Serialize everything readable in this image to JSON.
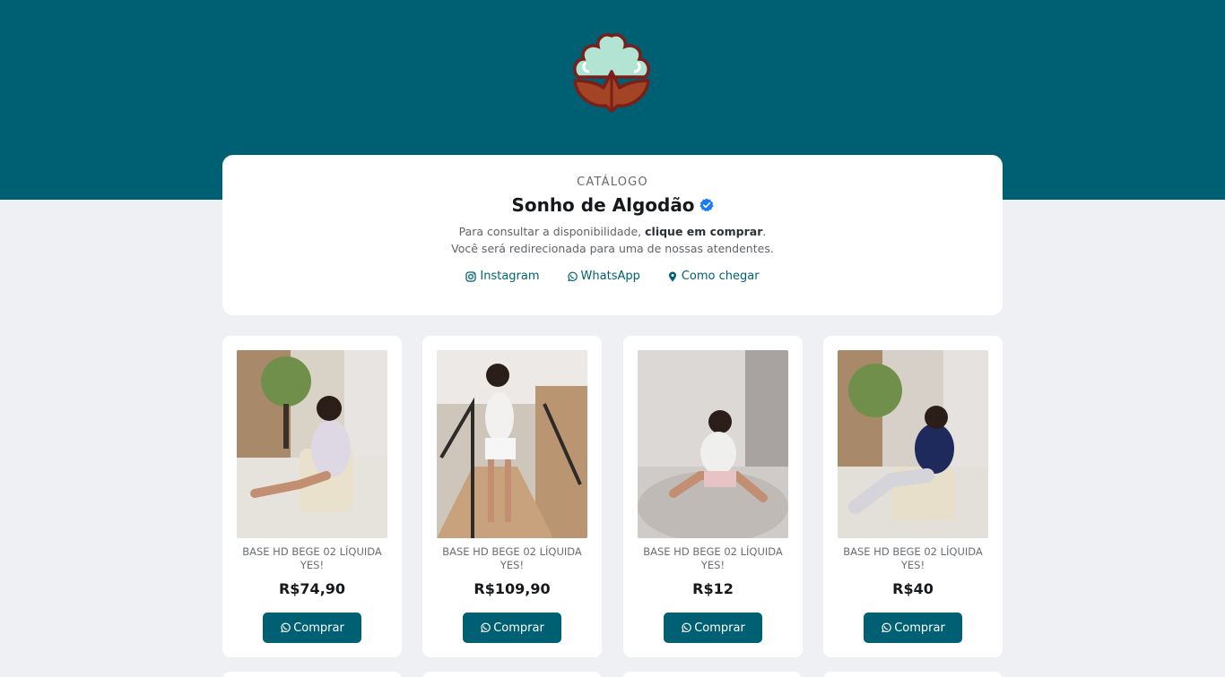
{
  "header": {
    "logo_icon": "cotton-flower-icon",
    "colors": {
      "brand": "#006073",
      "page_bg": "#eef0f4"
    }
  },
  "store": {
    "eyebrow": "CATÁLOGO",
    "name": "Sonho de Algodão",
    "verified_icon": "verified-badge-icon",
    "desc_pre": "Para consultar a disponibilidade, ",
    "desc_bold": "clique em comprar",
    "desc_post": ".",
    "desc_line2": "Você será redirecionada para uma de nossas atendentes.",
    "links": [
      {
        "label": "Instagram",
        "icon": "instagram-icon"
      },
      {
        "label": "WhatsApp",
        "icon": "whatsapp-icon"
      },
      {
        "label": "Como chegar",
        "icon": "map-pin-icon"
      }
    ]
  },
  "products": [
    {
      "name": "BASE HD BEGE 02 LÍQUIDA YES!",
      "price": "R$74,90",
      "button": "Comprar"
    },
    {
      "name": "BASE HD BEGE 02 LÍQUIDA YES!",
      "price": "R$109,90",
      "button": "Comprar"
    },
    {
      "name": "BASE HD BEGE 02 LÍQUIDA YES!",
      "price": "R$12",
      "button": "Comprar"
    },
    {
      "name": "BASE HD BEGE 02 LÍQUIDA YES!",
      "price": "R$40",
      "button": "Comprar"
    }
  ]
}
